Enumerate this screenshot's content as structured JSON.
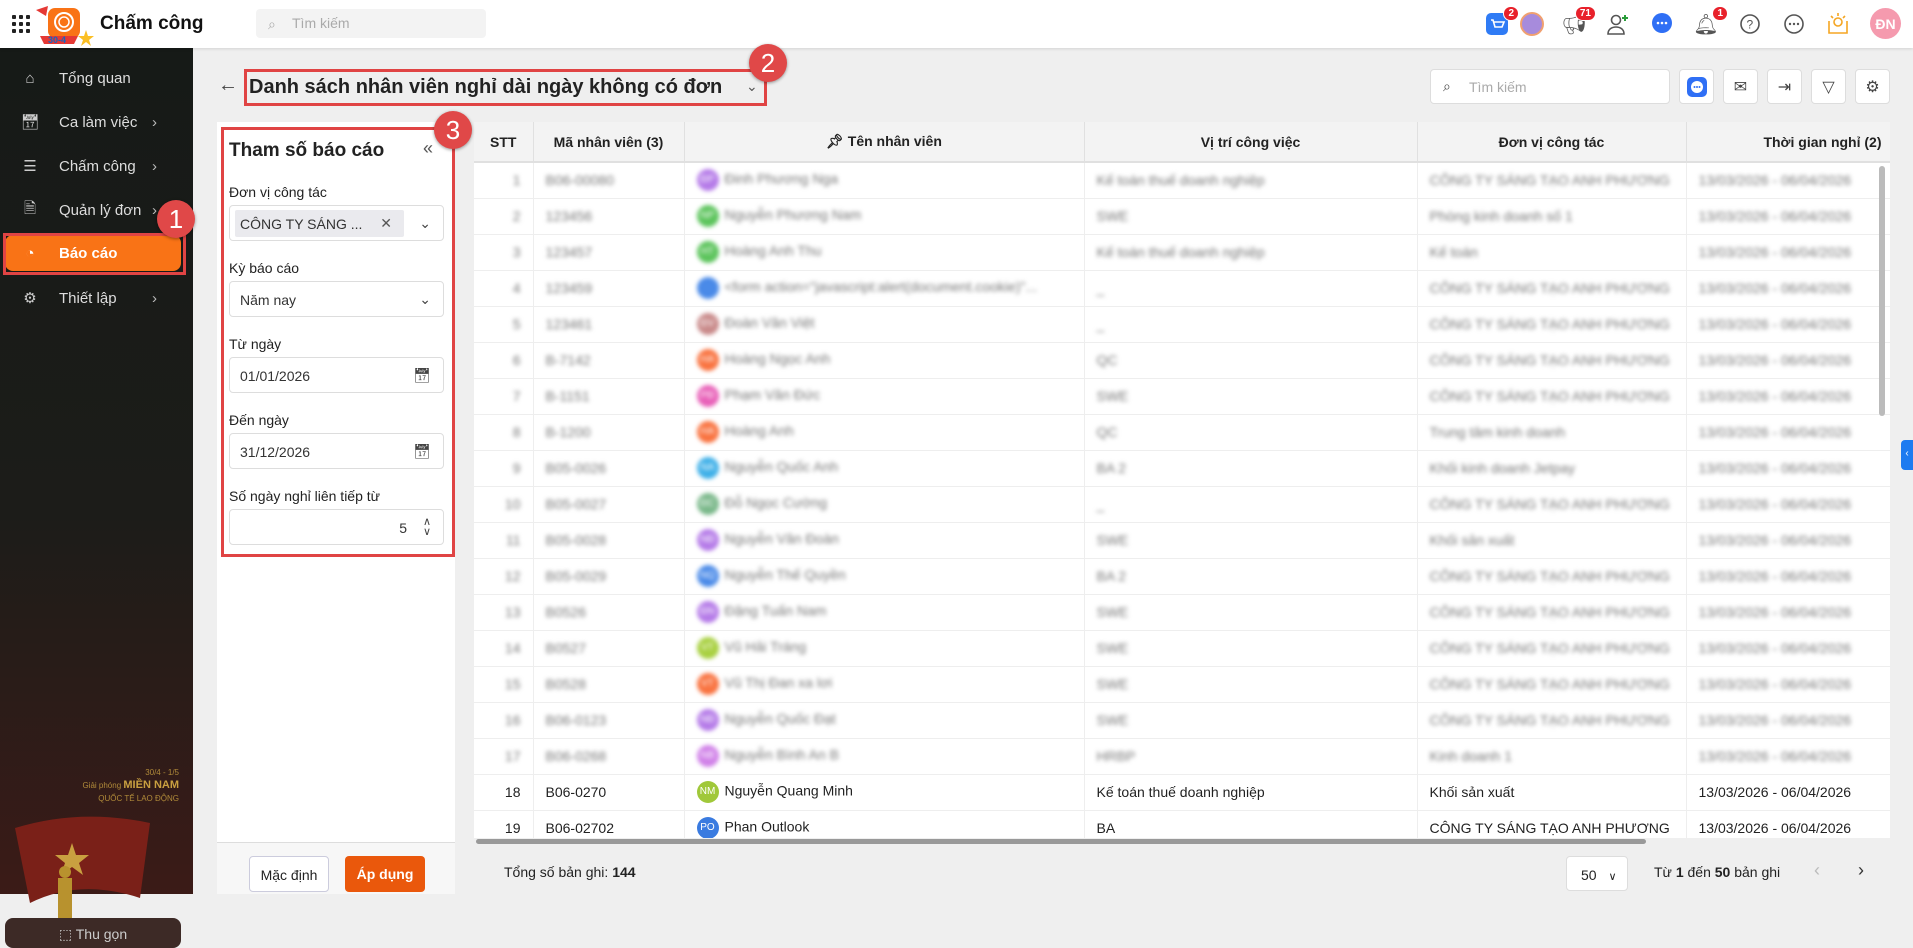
{
  "topbar": {
    "app_title": "Chấm công",
    "search_placeholder": "Tìm kiếm",
    "cart_badge": "2",
    "announce_badge": "71",
    "bell_badge": "1",
    "user_initials": "ĐN",
    "logo_text": "30-4"
  },
  "sidebar": {
    "items": [
      {
        "label": "Tổng quan"
      },
      {
        "label": "Ca làm việc"
      },
      {
        "label": "Chấm công"
      },
      {
        "label": "Quản lý đơn"
      },
      {
        "label": "Báo cáo"
      },
      {
        "label": "Thiết lập"
      }
    ],
    "collapse_label": "Thu gọn",
    "promo": {
      "date": "30/4 - 1/5",
      "line1_prefix": "Giải phóng",
      "line1_bold": "MIỀN NAM",
      "line2": "QUỐC TẾ LAO ĐỘNG"
    }
  },
  "annotations": [
    "1",
    "2",
    "3"
  ],
  "header": {
    "title": "Danh sách nhân viên nghỉ dài ngày không có đơn",
    "search_placeholder": "Tìm kiếm"
  },
  "panel": {
    "title": "Tham số báo cáo",
    "unit_label": "Đơn vị công tác",
    "unit_value": "CÔNG TY SÁNG ...",
    "period_label": "Kỳ báo cáo",
    "period_value": "Năm nay",
    "from_label": "Từ ngày",
    "from_value": "01/01/2026",
    "to_label": "Đến ngày",
    "to_value": "31/12/2026",
    "days_label": "Số ngày nghỉ liên tiếp từ",
    "days_value": "5",
    "default_btn": "Mặc định",
    "apply_btn": "Áp dụng"
  },
  "table": {
    "headers": [
      "STT",
      "Mã nhân viên (3)",
      "Tên nhân viên",
      "Vị trí công việc",
      "Đơn vị công tác",
      "Thời gian nghỉ (2)"
    ],
    "rows": [
      {
        "stt": "1",
        "code": "B06-00080",
        "initials": "ĐP",
        "color": "#b57be8",
        "name": "Đinh Phương Nga",
        "pos": "Kế toán thuế doanh nghiệp",
        "unit": "CÔNG TY SÁNG TẠO ANH PHƯƠNG",
        "time": "13/03/2026 - 06/04/2026"
      },
      {
        "stt": "2",
        "code": "123456",
        "initials": "NP",
        "color": "#5cc45c",
        "name": "Nguyễn Phương Nam",
        "pos": "SWE",
        "unit": "Phòng kinh doanh số 1",
        "time": "13/03/2026 - 06/04/2026"
      },
      {
        "stt": "3",
        "code": "123457",
        "initials": "HT",
        "color": "#5cc45c",
        "name": "Hoàng Anh Thu",
        "pos": "Kế toán thuế doanh nghiệp",
        "unit": "Kế toán",
        "time": "13/03/2026 - 06/04/2026"
      },
      {
        "stt": "4",
        "code": "123459",
        "initials": "",
        "color": "#4a8ae8",
        "name": "<form action=\"javascript:alert(document.cookie)\"...",
        "pos": "_",
        "unit": "CÔNG TY SÁNG TẠO ANH PHƯƠNG",
        "time": "13/03/2026 - 06/04/2026"
      },
      {
        "stt": "5",
        "code": "123461",
        "initials": "ĐV",
        "color": "#c98a8a",
        "name": "Đoàn Văn Việt",
        "pos": "_",
        "unit": "CÔNG TY SÁNG TẠO ANH PHƯƠNG",
        "time": "13/03/2026 - 06/04/2026"
      },
      {
        "stt": "6",
        "code": "B-7142",
        "initials": "HA",
        "color": "#f97340",
        "name": "Hoàng Ngọc Anh",
        "pos": "QC",
        "unit": "CÔNG TY SÁNG TẠO ANH PHƯƠNG",
        "time": "13/03/2026 - 06/04/2026"
      },
      {
        "stt": "7",
        "code": "B-1151",
        "initials": "PĐ",
        "color": "#e860b8",
        "name": "Phạm Văn Đức",
        "pos": "SWE",
        "unit": "CÔNG TY SÁNG TẠO ANH PHƯƠNG",
        "time": "13/03/2026 - 06/04/2026"
      },
      {
        "stt": "8",
        "code": "B-1200",
        "initials": "HA",
        "color": "#f97340",
        "name": "Hoàng Anh",
        "pos": "QC",
        "unit": "Trung tâm kinh doanh",
        "time": "13/03/2026 - 06/04/2026"
      },
      {
        "stt": "9",
        "code": "B05-0026",
        "initials": "NA",
        "color": "#3fb0e8",
        "name": "Nguyễn Quốc Anh",
        "pos": "BA 2",
        "unit": "Khối kinh doanh Jetpay",
        "time": "13/03/2026 - 06/04/2026"
      },
      {
        "stt": "10",
        "code": "B05-0027",
        "initials": "ĐC",
        "color": "#7ab88a",
        "name": "Đỗ Ngọc Cường",
        "pos": "_",
        "unit": "CÔNG TY SÁNG TẠO ANH PHƯƠNG",
        "time": "13/03/2026 - 06/04/2026"
      },
      {
        "stt": "11",
        "code": "B05-0028",
        "initials": "NĐ",
        "color": "#b57be8",
        "name": "Nguyễn Văn Đoàn",
        "pos": "SWE",
        "unit": "Khối sản xuất",
        "time": "13/03/2026 - 06/04/2026"
      },
      {
        "stt": "12",
        "code": "B05-0029",
        "initials": "NQ",
        "color": "#4a8ae8",
        "name": "Nguyễn Thế Quyền",
        "pos": "BA 2",
        "unit": "CÔNG TY SÁNG TẠO ANH PHƯƠNG",
        "time": "13/03/2026 - 06/04/2026"
      },
      {
        "stt": "13",
        "code": "B0526",
        "initials": "ĐN",
        "color": "#b57be8",
        "name": "Đặng Tuấn Nam",
        "pos": "SWE",
        "unit": "CÔNG TY SÁNG TẠO ANH PHƯƠNG",
        "time": "13/03/2026 - 06/04/2026"
      },
      {
        "stt": "14",
        "code": "B0527",
        "initials": "VT",
        "color": "#a8d040",
        "name": "Vũ Hải Tráng",
        "pos": "SWE",
        "unit": "CÔNG TY SÁNG TẠO ANH PHƯƠNG",
        "time": "13/03/2026 - 06/04/2026"
      },
      {
        "stt": "15",
        "code": "B0528",
        "initials": "VT",
        "color": "#f97340",
        "name": "Vũ Thị Đan xa lơi",
        "pos": "SWE",
        "unit": "CÔNG TY SÁNG TẠO ANH PHƯƠNG",
        "time": "13/03/2026 - 06/04/2026"
      },
      {
        "stt": "16",
        "code": "B06-0123",
        "initials": "NĐ",
        "color": "#b57be8",
        "name": "Nguyễn Quốc Đạt",
        "pos": "SWE",
        "unit": "CÔNG TY SÁNG TẠO ANH PHƯƠNG",
        "time": "13/03/2026 - 06/04/2026"
      },
      {
        "stt": "17",
        "code": "B06-0268",
        "initials": "NB",
        "color": "#d080e8",
        "name": "Nguyễn Bình An B",
        "pos": "HRBP",
        "unit": "Kinh doanh 1",
        "time": "13/03/2026 - 06/04/2026"
      },
      {
        "stt": "18",
        "code": "B06-0270",
        "initials": "NM",
        "color": "#a0c83a",
        "name": "Nguyễn Quang Minh",
        "pos": "Kế toán thuế doanh nghiệp",
        "unit": "Khối sản xuất",
        "time": "13/03/2026 - 06/04/2026"
      },
      {
        "stt": "19",
        "code": "B06-02702",
        "initials": "PO",
        "color": "#3a7be0",
        "name": "Phan Outlook",
        "pos": "BA",
        "unit": "CÔNG TY SÁNG TẠO ANH PHƯƠNG",
        "time": "13/03/2026 - 06/04/2026"
      }
    ]
  },
  "footer": {
    "total_label": "Tổng số bản ghi:",
    "total_value": "144",
    "page_size": "50",
    "range_from_label": "Từ",
    "range_from": "1",
    "range_to_label": "đến",
    "range_to": "50",
    "range_suffix": "bản ghi"
  },
  "colors": {
    "accent": "#f97316",
    "apply": "#ea580c",
    "annotation": "#e04848"
  }
}
